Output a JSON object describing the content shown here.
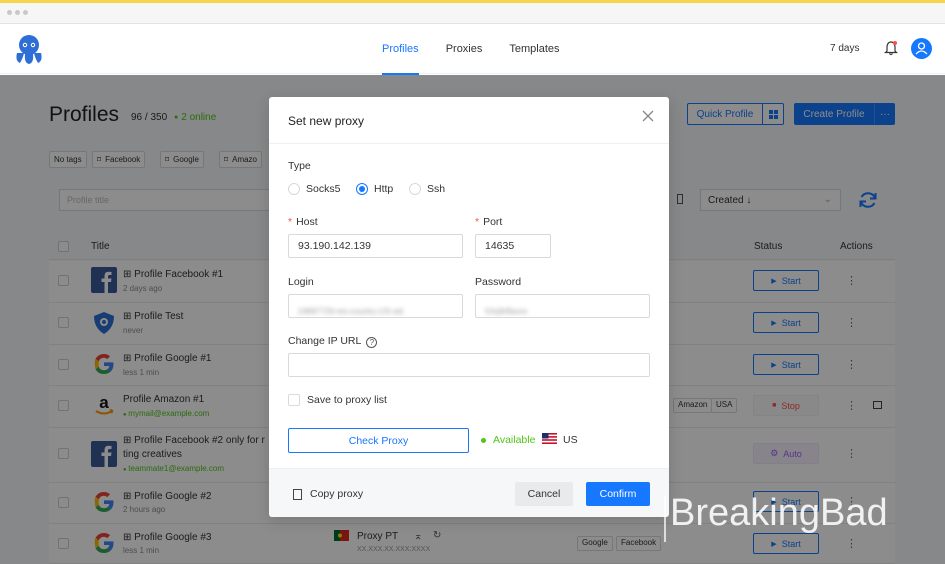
{
  "app": {
    "nav": [
      "Profiles",
      "Proxies",
      "Templates"
    ],
    "active_tab": "Profiles",
    "days_left": "7 days"
  },
  "page": {
    "title": "Profiles",
    "count": "96 / 350",
    "online": "2 online",
    "quick_profile": "Quick Profile",
    "create_profile": "Create Profile",
    "more": "···",
    "tags": [
      "No tags",
      "Facebook",
      "Google",
      "Amazo"
    ],
    "search_placeholder": "Profile title",
    "sort": "Created ↓"
  },
  "table": {
    "headers": {
      "title": "Title",
      "status": "Status",
      "actions": "Actions"
    },
    "rows": [
      {
        "name": "Profile Facebook #1",
        "sub": "2 days ago",
        "icon": "facebook-logo",
        "status": "Start"
      },
      {
        "name": "Profile Test",
        "sub": "never",
        "icon": "shield-logo",
        "status": "Start"
      },
      {
        "name": "Profile Google #1",
        "sub": "less 1 min",
        "icon": "google-logo",
        "status": "Start"
      },
      {
        "name": "Profile Amazon #1",
        "sub": "mymail@example.com",
        "icon": "amazon-logo",
        "status": "Stop",
        "tags": [
          "Amazon",
          "USA"
        ]
      },
      {
        "name": "Profile Facebook #2 only for r",
        "name2": "ting creatives",
        "sub": "teammate1@example.com",
        "icon": "facebook-logo",
        "status": "Auto"
      },
      {
        "name": "Profile Google #2",
        "sub": "2 hours ago",
        "icon": "google-logo",
        "status": "Start"
      },
      {
        "name": "Profile Google #3",
        "sub": "less 1 min",
        "icon": "google-logo",
        "status": "Start",
        "proxy": "Proxy PT",
        "proxy_ip": "XX.XXX.XX.XXX:XXXX",
        "tags": [
          "Google",
          "Facebook"
        ]
      }
    ],
    "row_action": "⋮"
  },
  "modal": {
    "title": "Set new proxy",
    "type_label": "Type",
    "types": [
      "Socks5",
      "Http",
      "Ssh"
    ],
    "selected_type": "Http",
    "host_label": "Host",
    "host_value": "93.190.142.139",
    "port_label": "Port",
    "port_value": "14635",
    "login_label": "Login",
    "login_value": "24897729-res-country-US-sid",
    "password_label": "Password",
    "password_value": "5Xq9rBavre",
    "change_ip_label": "Change IP URL",
    "change_ip_value": "",
    "save_label": "Save to proxy list",
    "check_label": "Check Proxy",
    "available": "Available",
    "country": "US",
    "copy_label": "Copy proxy",
    "cancel_label": "Cancel",
    "confirm_label": "Confirm"
  },
  "watermark": "BreakingBad",
  "colors": {
    "accent": "#1677ff",
    "online": "#52c41a",
    "danger": "#ff4d4f",
    "auto": "#a060f0"
  }
}
